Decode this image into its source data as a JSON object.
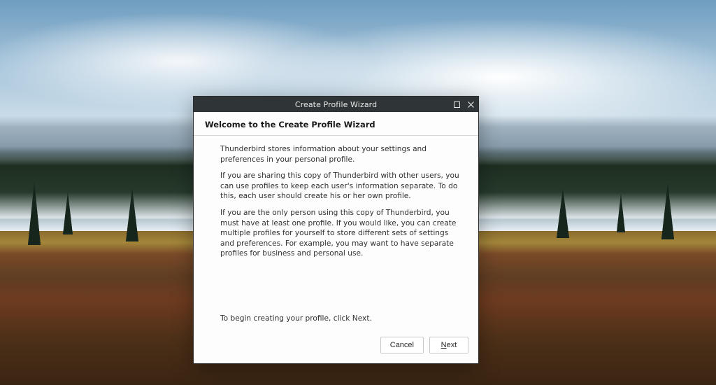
{
  "window": {
    "title": "Create Profile Wizard"
  },
  "wizard": {
    "heading": "Welcome to the Create Profile Wizard",
    "paragraphs": {
      "p1": "Thunderbird stores information about your settings and preferences in your personal profile.",
      "p2": "If you are sharing this copy of Thunderbird with other users, you can use profiles to keep each user's information separate. To do this, each user should create his or her own profile.",
      "p3": "If you are the only person using this copy of Thunderbird, you must have at least one profile. If you would like, you can create multiple profiles for yourself to store different sets of settings and preferences. For example, you may want to have separate profiles for business and personal use."
    },
    "instruction": "To begin creating your profile, click Next."
  },
  "buttons": {
    "cancel": "Cancel",
    "next_prefix": "N",
    "next_rest": "ext"
  },
  "icons": {
    "maximize": "maximize-icon",
    "close": "close-icon"
  }
}
